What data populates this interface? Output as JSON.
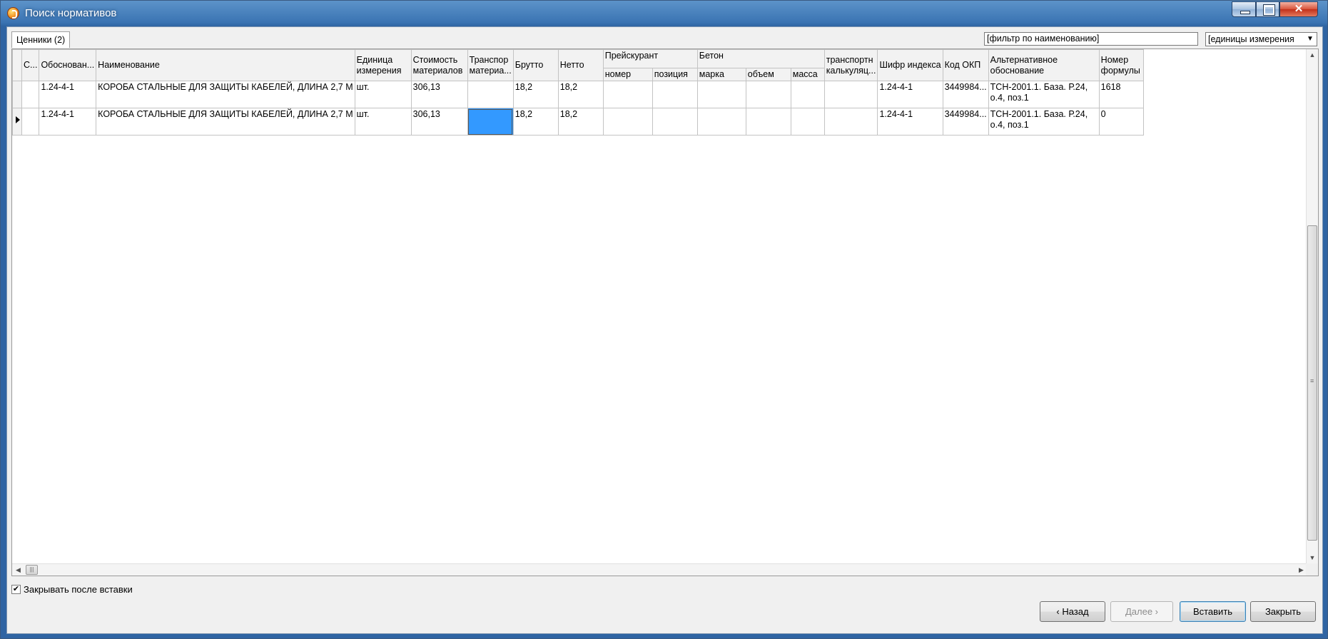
{
  "window": {
    "title": "Поиск нормативов",
    "controls": {
      "minimize": "_",
      "maximize": "□",
      "close": "✕"
    }
  },
  "tab": {
    "label": "Ценники (2)"
  },
  "filter": {
    "value": "[фильтр по наименованию]"
  },
  "units_select": {
    "value": "[единицы измерения",
    "arrow": "▼"
  },
  "grid": {
    "headers": {
      "c": "С...",
      "obosnovanie": "Обоснован...",
      "naimenovanie": "Наименование",
      "edinica": "Единица измерения",
      "stoimost": "Стоимость материалов",
      "transport": "Транспор материа...",
      "brutto": "Брутто",
      "netto": "Нетто",
      "preyskurant": "Прейскурант",
      "preyskurant_nomer": "номер",
      "preyskurant_pozitsiya": "позиция",
      "beton": "Бетон",
      "beton_marka": "марка",
      "beton_obem": "объем",
      "beton_massa": "масса",
      "transportnaya_kalk": "транспортн калькуляц...",
      "shifr": "Шифр индекса",
      "kod_okp": "Код ОКП",
      "alt_obosnovanie": "Альтернативное обоснование",
      "nomer_formuly": "Номер формулы"
    },
    "rows": [
      {
        "obosnovanie": "1.24-4-1",
        "naimenovanie": "КОРОБА СТАЛЬНЫЕ ДЛЯ ЗАЩИТЫ КАБЕЛЕЙ, ДЛИНА 2,7 М",
        "edinica": "шт.",
        "stoimost": "306,13",
        "transport": "",
        "brutto": "18,2",
        "netto": "18,2",
        "shifr": "1.24-4-1",
        "kod_okp": "3449984...",
        "alt_obosnovanie": "ТСН-2001.1. База. Р.24, о.4, поз.1",
        "nomer_formuly": "1618"
      },
      {
        "obosnovanie": "1.24-4-1",
        "naimenovanie": "КОРОБА СТАЛЬНЫЕ ДЛЯ ЗАЩИТЫ КАБЕЛЕЙ, ДЛИНА 2,7 М",
        "edinica": "шт.",
        "stoimost": "306,13",
        "transport": "",
        "brutto": "18,2",
        "netto": "18,2",
        "shifr": "1.24-4-1",
        "kod_okp": "3449984...",
        "alt_obosnovanie": "ТСН-2001.1. База. Р.24, о.4, поз.1",
        "nomer_formuly": "0"
      }
    ]
  },
  "close_after_insert": {
    "label": "Закрывать после вставки",
    "checked": true,
    "mark": "✔"
  },
  "buttons": {
    "back": "‹ Назад",
    "next": "Далее ›",
    "insert": "Вставить",
    "close": "Закрыть"
  },
  "colors": {
    "selection": "#3399ff",
    "titlebar": "#3b74b3"
  }
}
